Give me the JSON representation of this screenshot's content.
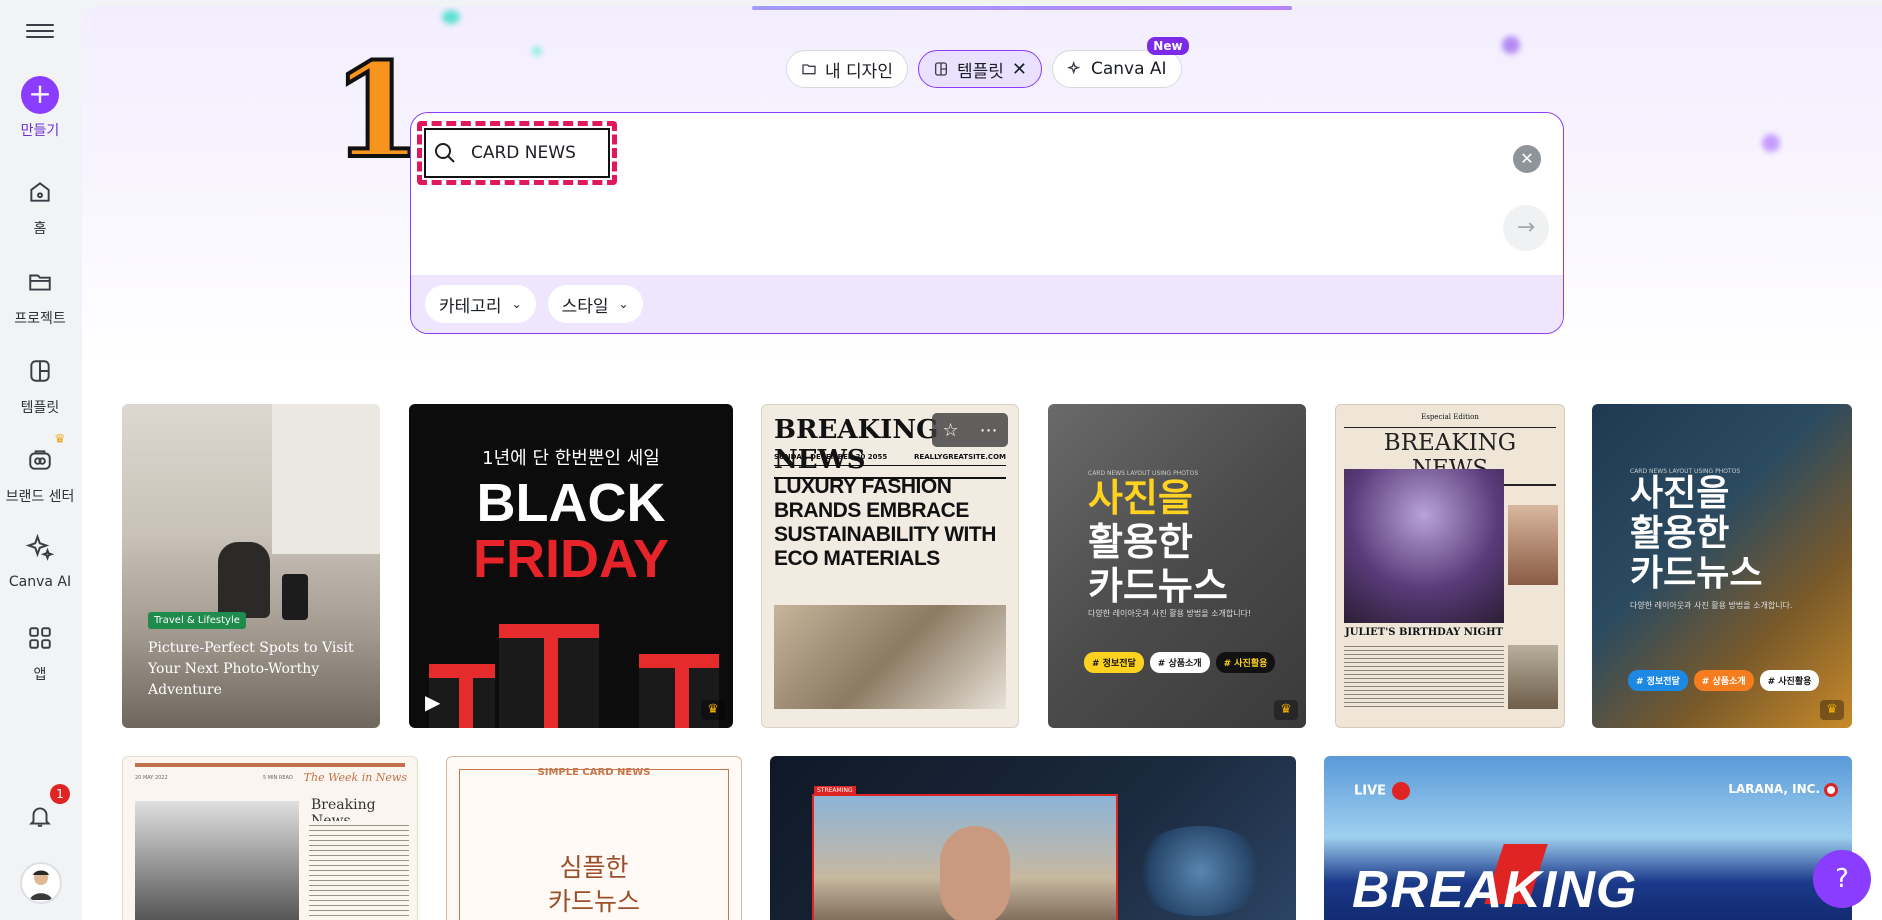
{
  "sidebar": {
    "create_label": "만들기",
    "items": [
      {
        "label": "홈",
        "icon": "home-icon"
      },
      {
        "label": "프로젝트",
        "icon": "folder-icon"
      },
      {
        "label": "템플릿",
        "icon": "template-icon"
      },
      {
        "label": "브랜드 센터",
        "icon": "brand-icon"
      },
      {
        "label": "Canva AI",
        "icon": "sparkle-icon"
      },
      {
        "label": "앱",
        "icon": "apps-icon"
      }
    ],
    "notifications_count": "1"
  },
  "tabs": [
    {
      "label": "내 디자인",
      "icon": "folder-icon"
    },
    {
      "label": "템플릿",
      "icon": "template-icon",
      "active": true
    },
    {
      "label": "Canva AI",
      "icon": "sparkle-icon",
      "badge": "New"
    }
  ],
  "annotation_number": "1",
  "search": {
    "query": "CARD NEWS",
    "filters": [
      "카테고리",
      "스타일"
    ]
  },
  "templates": {
    "t1": {
      "tag": "Travel & Lifestyle",
      "caption": "Picture-Perfect Spots to Visit Your Next Photo-Worthy Adventure"
    },
    "t2": {
      "subtitle": "1년에 단 한번뿐인 세일",
      "line1": "BLACK",
      "line2": "FRIDAY"
    },
    "t3": {
      "masthead": "BREAKING NEWS",
      "date": "SUNDAY, DECEMBER 20 2055",
      "site": "REALLYGREATSITE.COM",
      "headline": "LUXURY FASHION BRANDS EMBRACE SUSTAINABILITY WITH ECO MATERIALS"
    },
    "t4": {
      "top": "CARD NEWS LAYOUT USING PHOTOS",
      "line1": "사진을",
      "line2": "활용한",
      "line3": "카드뉴스",
      "desc": "다양한 레이아웃과 사진 활용 방법을 소개합니다!",
      "tags": [
        "# 정보전달",
        "# 상품소개",
        "# 사진활용"
      ]
    },
    "t5": {
      "edition": "Especial Edition",
      "masthead": "BREAKING NEWS",
      "caption": "JULIET'S BIRTHDAY NIGHT"
    },
    "t6": {
      "top": "CARD NEWS LAYOUT USING PHOTOS",
      "line1": "사진을",
      "line2": "활용한",
      "line3": "카드뉴스",
      "desc": "다양한 레이아웃과 사진 활용 방법을 소개합니다.",
      "tags": [
        "# 정보전달",
        "# 상품소개",
        "# 사진활용"
      ]
    },
    "r2a": {
      "date": "20 MAY 2022",
      "issue": "5 MIN READ",
      "kicker": "The Week in News",
      "title": "Breaking News"
    },
    "r2b": {
      "title": "SIMPLE CARD NEWS",
      "line1": "심플한",
      "line2": "카드뉴스"
    },
    "r2c": {
      "badge": "STREAMING"
    },
    "r2d": {
      "live": "LIVE",
      "corp": "LARANA, INC.",
      "title": "BREAKING"
    }
  },
  "colors": {
    "brand": "#8b3dff",
    "annotation_frame": "#e0195c",
    "annotation_number": "#f7941d"
  },
  "help": "?"
}
